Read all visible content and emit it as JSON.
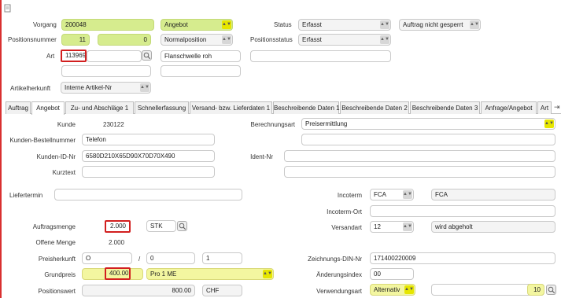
{
  "header": {
    "vorgang_label": "Vorgang",
    "vorgang_value": "200048",
    "vorgang_type": "Angebot",
    "status_label": "Status",
    "status_value": "Erfasst",
    "lock_status": "Auftrag nicht gesperrt",
    "positionsnummer_label": "Positionsnummer",
    "positionsnummer_value": "11",
    "positionsnummer_sub": "0",
    "position_type": "Normalposition",
    "positionsstatus_label": "Positionsstatus",
    "positionsstatus_value": "Erfasst",
    "art_label": "Art",
    "art_value": "113969",
    "art_description": "Flanschwelle roh",
    "artikelherkunft_label": "Artikelherkunft",
    "artikelherkunft_value": "Interne Artikel-Nr"
  },
  "tabs": [
    {
      "label": "Auftrag"
    },
    {
      "label": "Angebot"
    },
    {
      "label": "Zu- und Abschläge 1"
    },
    {
      "label": "Schnellerfassung"
    },
    {
      "label": "Versand- bzw. Lieferdaten 1"
    },
    {
      "label": "Beschreibende Daten 1"
    },
    {
      "label": "Beschreibende Daten 2"
    },
    {
      "label": "Beschreibende Daten 3"
    },
    {
      "label": "Anfrage/Angebot"
    },
    {
      "label": "Art"
    }
  ],
  "tab_scroll_glyph": "⇥",
  "form": {
    "kunde_label": "Kunde",
    "kunde_value": "230122",
    "berechnungsart_label": "Berechnungsart",
    "berechnungsart_value": "Preisermittlung",
    "kunden_bestellnummer_label": "Kunden-Bestellnummer",
    "kunden_bestellnummer_value": "Telefon",
    "kunden_id_label": "Kunden-ID-Nr",
    "kunden_id_value": "6580D210X65D90X70D70X490",
    "ident_nr_label": "Ident-Nr",
    "kurztext_label": "Kurztext",
    "liefertermin_label": "Liefertermin",
    "incoterm_label": "Incoterm",
    "incoterm_value": "FCA",
    "incoterm_desc": "FCA",
    "incoterm_ort_label": "Incoterm-Ort",
    "auftragsmenge_label": "Auftragsmenge",
    "auftragsmenge_value": "2.000",
    "unit_value": "STK",
    "versandart_label": "Versandart",
    "versandart_value": "12",
    "versandart_desc": "wird abgeholt",
    "offene_menge_label": "Offene Menge",
    "offene_menge_value": "2.000",
    "preisherkunft_label": "Preisherkunft",
    "preisherkunft_value": "O",
    "slash": "/",
    "preis_a": "0",
    "preis_b": "1",
    "zeichnungs_label": "Zeichnungs-DIN-Nr",
    "zeichnungs_value": "171400220009",
    "grundpreis_label": "Grundpreis",
    "grundpreis_value": "400.00",
    "preiseinheit_value": "Pro 1 ME",
    "aenderungsindex_label": "Änderungsindex",
    "aenderungsindex_value": "00",
    "positionswert_label": "Positionswert",
    "positionswert_value": "800.00",
    "currency_value": "CHF",
    "verwendungsart_label": "Verwendungsart",
    "verwendungsart_value": "Alternativ",
    "verwendungsart_num": "10"
  },
  "colors": {
    "highlight_green": "#d6ec8e",
    "highlight_yellow": "#f3f6a0",
    "error_red": "#d21f1f"
  }
}
